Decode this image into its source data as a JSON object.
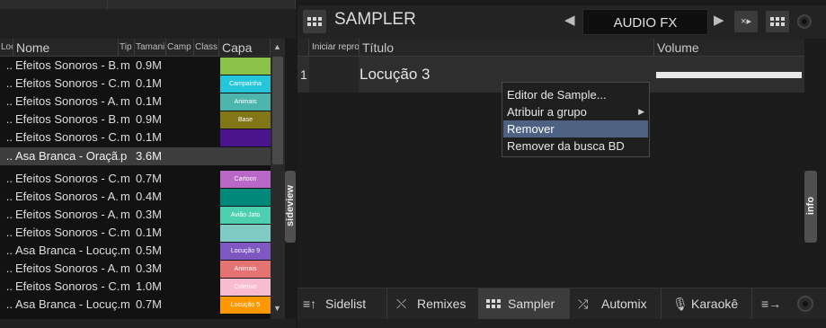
{
  "library": {
    "columns": [
      {
        "label": "Loc",
        "key": "loc"
      },
      {
        "label": "Nome",
        "key": "nome"
      },
      {
        "label": "Tip",
        "key": "tip"
      },
      {
        "label": "Tamani",
        "key": "tam"
      },
      {
        "label": "Camp",
        "key": "camp"
      },
      {
        "label": "Class",
        "key": "class"
      },
      {
        "label": "Capa",
        "key": "capa"
      }
    ],
    "rows": [
      {
        "dot": "..",
        "name": "Efeitos Sonoros - B...",
        "tip": "m",
        "size": "0.9M",
        "cover": "",
        "cover_color": "#8bc34a"
      },
      {
        "dot": "..",
        "name": "Efeitos Sonoros - C...",
        "tip": "m",
        "size": "0.1M",
        "cover": "Campainha",
        "cover_color": "#26c6da"
      },
      {
        "dot": "..",
        "name": "Efeitos Sonoros - A...",
        "tip": "m",
        "size": "0.1M",
        "cover": "Animais",
        "cover_color": "#4db6ac"
      },
      {
        "dot": "..",
        "name": "Efeitos Sonoros - B...",
        "tip": "m",
        "size": "0.9M",
        "cover": "Base",
        "cover_color": "#827717"
      },
      {
        "dot": "..",
        "name": "Efeitos Sonoros - C...",
        "tip": "m",
        "size": "0.1M",
        "cover": "",
        "cover_color": "#4a148c"
      },
      {
        "dot": "..",
        "name": "Asa Branca - Oraçã...",
        "tip": "p",
        "size": "3.6M",
        "cover": "",
        "cover_color": ""
      },
      {
        "dot": "..",
        "name": "Efeitos Sonoros - C...",
        "tip": "m",
        "size": "0.7M",
        "cover": "Cartoon",
        "cover_color": "#ba68c8"
      },
      {
        "dot": "..",
        "name": "Efeitos Sonoros - A...",
        "tip": "m",
        "size": "0.4M",
        "cover": "",
        "cover_color": "#00897b"
      },
      {
        "dot": "..",
        "name": "Efeitos Sonoros - A...",
        "tip": "m",
        "size": "0.3M",
        "cover": "Avião Jato",
        "cover_color": "#4dd0b0"
      },
      {
        "dot": "..",
        "name": "Efeitos Sonoros - C...",
        "tip": "m",
        "size": "0.1M",
        "cover": "",
        "cover_color": "#80cbc4"
      },
      {
        "dot": "..",
        "name": "Asa Branca - Locuç...",
        "tip": "m",
        "size": "0.5M",
        "cover": "Locução 9",
        "cover_color": "#7e57c2"
      },
      {
        "dot": "..",
        "name": "Efeitos Sonoros - A...",
        "tip": "m",
        "size": "0.3M",
        "cover": "Animais",
        "cover_color": "#e57373"
      },
      {
        "dot": "..",
        "name": "Efeitos Sonoros - C...",
        "tip": "m",
        "size": "1.0M",
        "cover": "Coletivo",
        "cover_color": "#f8bbd0"
      },
      {
        "dot": "..",
        "name": "Asa Branca - Locuç...",
        "tip": "m",
        "size": "0.7M",
        "cover": "Locução 5",
        "cover_color": "#ff9800"
      }
    ],
    "sideview_label": "sideview"
  },
  "sampler": {
    "title": "SAMPLER",
    "fx_label": "AUDIO FX",
    "columns": [
      {
        "label": "Iniciar repro"
      },
      {
        "label": "Título"
      },
      {
        "label": "Volume"
      }
    ],
    "rows": [
      {
        "number": "1",
        "title": "Locução 3",
        "volume": 1.0
      }
    ],
    "info_label": "info"
  },
  "context_menu": {
    "items": [
      {
        "label": "Editor de Sample...",
        "has_submenu": false,
        "active": false
      },
      {
        "label": "Atribuir a grupo",
        "has_submenu": true,
        "active": false
      },
      {
        "label": "Remover",
        "has_submenu": false,
        "active": true
      },
      {
        "label": "Remover da busca BD",
        "has_submenu": false,
        "active": false
      }
    ]
  },
  "tabs": [
    {
      "label": "Sidelist",
      "icon": "sidelist-icon",
      "active": false
    },
    {
      "label": "Remixes",
      "icon": "remixes-icon",
      "active": false
    },
    {
      "label": "Sampler",
      "icon": "grid-icon",
      "active": true
    },
    {
      "label": "Automix",
      "icon": "shuffle-icon",
      "active": false
    },
    {
      "label": "Karaokê",
      "icon": "microphone-icon",
      "active": false
    }
  ]
}
